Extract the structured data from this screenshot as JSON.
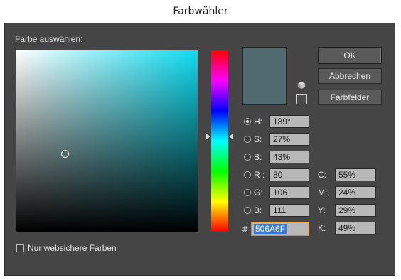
{
  "window": {
    "title": "Farbwähler"
  },
  "picker": {
    "choose_label": "Farbe auswählen:",
    "current_color": "#506A6F",
    "hue_color": "#0DDBF0"
  },
  "buttons": {
    "ok": "OK",
    "cancel": "Abbrechen",
    "swatches": "Farbfelder"
  },
  "hsb": {
    "h_label": "H:",
    "h_value": "189°",
    "s_label": "S:",
    "s_value": "27%",
    "b_label": "B:",
    "b_value": "43%"
  },
  "rgb": {
    "r_label": "R :",
    "r_value": "80",
    "g_label": "G:",
    "g_value": "106",
    "b_label": "B:",
    "b_value": "111"
  },
  "cmyk": {
    "c_label": "C:",
    "c_value": "55%",
    "m_label": "M:",
    "m_value": "24%",
    "y_label": "Y:",
    "y_value": "29%",
    "k_label": "K:",
    "k_value": "49%"
  },
  "hex": {
    "label": "#",
    "value": "506A6F"
  },
  "websafe": {
    "label": "Nur websichere Farben",
    "checked": false
  },
  "icons": {
    "gamut_cube": "cube-icon"
  }
}
